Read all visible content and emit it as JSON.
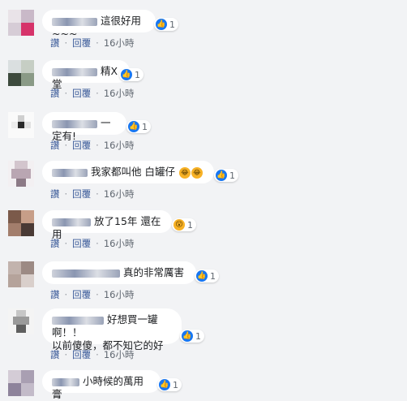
{
  "comments": [
    {
      "text": "這很好用~~~",
      "reaction_count": "1",
      "reaction": "like-icon",
      "time": "16小時"
    },
    {
      "text": "精X堂",
      "reaction_count": "1",
      "reaction": "like-icon",
      "time": "16小時"
    },
    {
      "text": "一定有!",
      "reaction_count": "1",
      "reaction": "like-icon",
      "time": "16小時"
    },
    {
      "text": "我家都叫他 白罐仔",
      "reaction_count": "1",
      "reaction": "like-icon",
      "time": "16小時"
    },
    {
      "text": "放了15年 還在用",
      "reaction_count": "1",
      "reaction": "wow-icon",
      "time": "16小時"
    },
    {
      "text": "真的非常厲害",
      "reaction_count": "1",
      "reaction": "like-icon",
      "time": "16小時"
    },
    {
      "text_line1": "好想買一罐啊！！",
      "text_line2": "以前傻傻，都不知它的好",
      "reaction_count": "1",
      "reaction": "like-icon",
      "time": "16小時"
    },
    {
      "text": "小時候的萬用膏",
      "reaction_count": "1",
      "reaction": "like-icon",
      "time": ""
    }
  ],
  "actions": {
    "like": "讚",
    "reply": "回覆",
    "dot": "·"
  },
  "colors": {
    "link": "#385898",
    "meta": "#606770",
    "bubble": "#ffffff",
    "bg": "#f2f3f5",
    "like_blue": "#1877f2"
  }
}
